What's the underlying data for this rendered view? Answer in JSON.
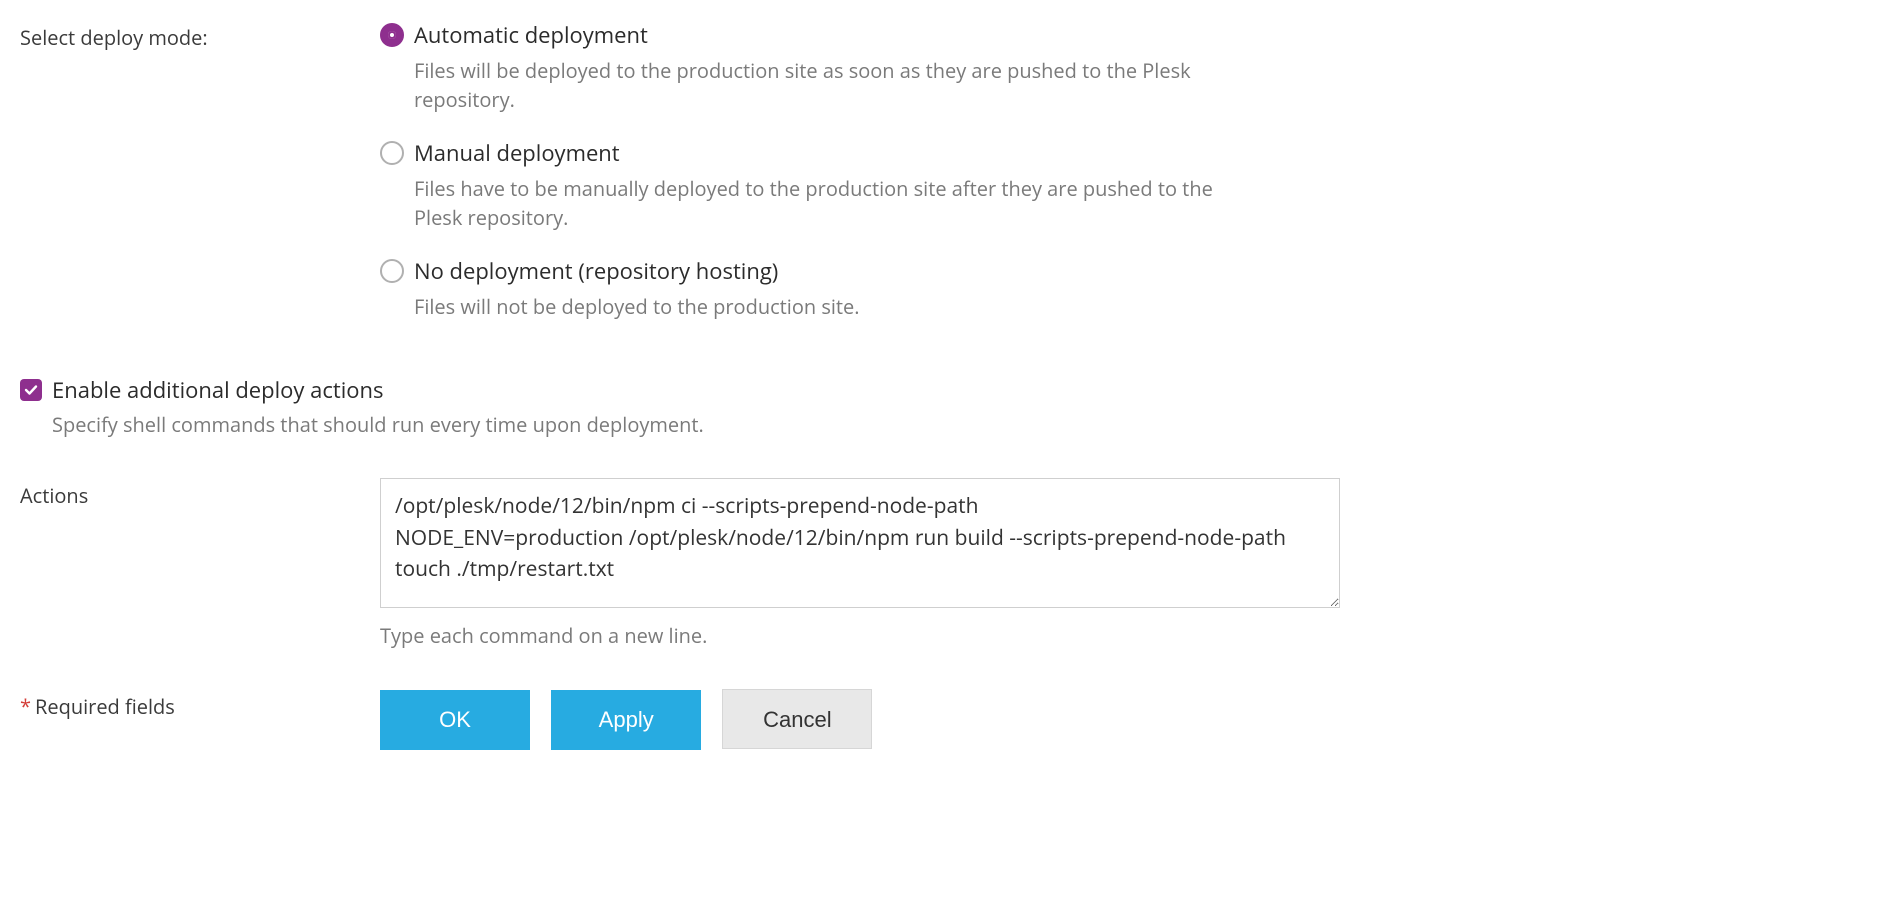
{
  "deploy_mode": {
    "label": "Select deploy mode:",
    "options": [
      {
        "title": "Automatic deployment",
        "desc": "Files will be deployed to the production site as soon as they are pushed to the Plesk repository.",
        "selected": true
      },
      {
        "title": "Manual deployment",
        "desc": "Files have to be manually deployed to the production site after they are pushed to the Plesk repository.",
        "selected": false
      },
      {
        "title": "No deployment (repository hosting)",
        "desc": "Files will not be deployed to the production site.",
        "selected": false
      }
    ]
  },
  "deploy_actions_checkbox": {
    "label": "Enable additional deploy actions",
    "desc": "Specify shell commands that should run every time upon deployment.",
    "checked": true
  },
  "actions": {
    "label": "Actions",
    "value": "/opt/plesk/node/12/bin/npm ci --scripts-prepend-node-path\nNODE_ENV=production /opt/plesk/node/12/bin/npm run build --scripts-prepend-node-path\ntouch ./tmp/restart.txt",
    "hint": "Type each command on a new line."
  },
  "required_note": "Required fields",
  "buttons": {
    "ok": "OK",
    "apply": "Apply",
    "cancel": "Cancel"
  }
}
